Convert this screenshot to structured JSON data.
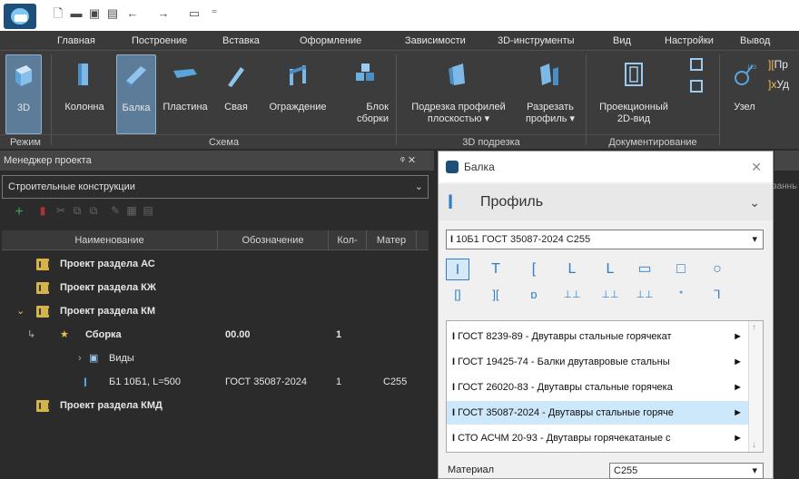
{
  "quick_access": {
    "icons": [
      "new-file-icon",
      "open-folder-icon",
      "save-icon",
      "save-all-icon",
      "undo-icon",
      "redo-icon",
      "print-icon",
      "customize-icon"
    ]
  },
  "menu": [
    "Главная",
    "Построение",
    "Вставка",
    "Оформление",
    "Зависимости",
    "3D-инструменты",
    "Вид",
    "Настройки",
    "Вывод"
  ],
  "ribbon": {
    "buttons": [
      {
        "label": "3D",
        "icon": "cube-icon"
      },
      {
        "label": "Колонна",
        "icon": "column-icon"
      },
      {
        "label": "Балка",
        "icon": "beam-icon"
      },
      {
        "label": "Пластина",
        "icon": "plate-icon"
      },
      {
        "label": "Свая",
        "icon": "pile-icon"
      },
      {
        "label": "Ограждение",
        "icon": "fence-icon"
      },
      {
        "label": "Блок\nсборки",
        "icon": "assembly-block-icon"
      },
      {
        "label": "Подрезка профилей\nплоскостью ▾",
        "icon": "trim-profile-icon"
      },
      {
        "label": "Разрезать\nпрофиль ▾",
        "icon": "cut-profile-icon"
      },
      {
        "label": "Проекционный\n2D-вид",
        "icon": "projection-view-icon"
      },
      {
        "label": "Узел",
        "icon": "node-icon"
      }
    ],
    "groups": [
      "Режим",
      "Схема",
      "3D подрезка",
      "Документирование"
    ],
    "extra": [
      "Пр",
      "Уд"
    ]
  },
  "project_manager": {
    "title": "Менеджер проекта",
    "controls": "ᵠ ✕",
    "combo_value": "Строительные конструкции",
    "columns": [
      "Наименование",
      "Обозначение",
      "Кол-",
      "Матер"
    ],
    "rows": [
      {
        "name": "Проект раздела АС"
      },
      {
        "name": "Проект раздела КЖ"
      },
      {
        "name": "Проект раздела КМ"
      },
      {
        "name": "Сборка",
        "designation": "00.00",
        "qty": "1"
      },
      {
        "name": "Виды"
      },
      {
        "name": "Б1   10Б1, L=500",
        "designation": "ГОСТ 35087-2024",
        "qty": "1",
        "material": "С255"
      },
      {
        "name": "Проект раздела КМД"
      }
    ]
  },
  "dialog": {
    "title": "Балка",
    "section": "Профиль",
    "profile_value": "10Б1 ГОСТ 35087-2024 С255",
    "shapes_row1": [
      "I",
      "T",
      "[",
      "L",
      "L",
      "▭",
      "□",
      "○"
    ],
    "shapes_row2": [
      "[]",
      "][",
      "ɒ",
      "⊥⊥",
      "⊥⊥",
      "⊥⊥",
      "ᐩ",
      "⅂"
    ],
    "standards": [
      "ГОСТ 8239-89 - Двутавры стальные горячекат",
      "ГОСТ 19425-74 - Балки двутавровые стальны",
      "ГОСТ 26020-83 - Двутавры стальные горячека",
      "ГОСТ 35087-2024 - Двутавры стальные горяче",
      "СТО АСЧМ 20-93 - Двутавры горячекатаные с"
    ],
    "selected_index": 3,
    "material_label": "Материал",
    "material_value": "С255"
  },
  "background_text": "занны",
  "colors": {
    "accent": "#2f7ec8",
    "selection": "#cde8fb",
    "ribbon_active": "#5d7c9a",
    "folder": "#d6b24a"
  }
}
